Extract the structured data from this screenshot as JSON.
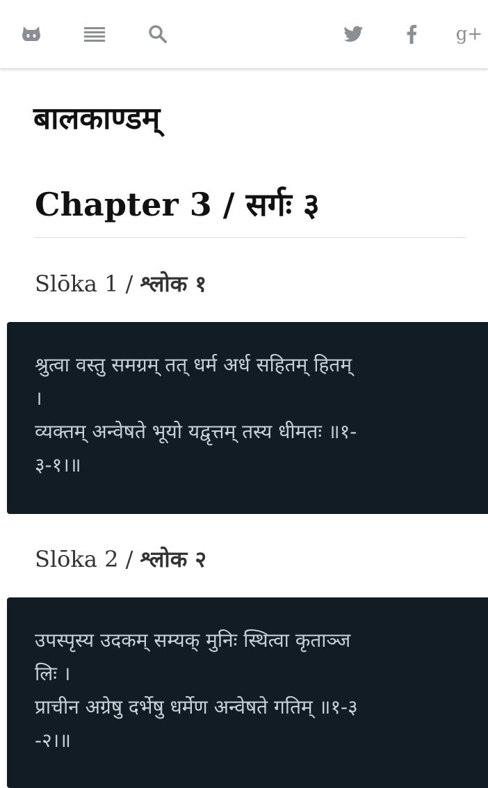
{
  "nav": {
    "left_icons": [
      "github-icon",
      "list-icon",
      "search-icon"
    ],
    "right_icons": [
      "twitter-icon",
      "facebook-icon",
      "google-plus-icon"
    ],
    "gplus_label": "g+"
  },
  "book_title": "बालकाण्डम्",
  "chapter_title": "Chapter 3 / सर्गः ३",
  "slokas": [
    {
      "heading_prefix": "Slōka 1 / ",
      "heading_deva": "श्लोक १",
      "text": "श्रुत्वा वस्तु समग्रम् तत् धर्म अर्ध सहितम् हितम्\n।\nव्यक्तम् अन्वेषते भूयो यद्वृत्तम् तस्य धीमतः ॥१-\n३-१।॥"
    },
    {
      "heading_prefix": "Slōka 2 / ",
      "heading_deva": "श्लोक २",
      "text": "उपस्पृस्य उदकम् सम्यक् मुनिः स्थित्वा कृताञ्ज\nलिः ।\nप्राचीन अग्रेषु दर्भेषु धर्मेण अन्वेषते गतिम् ॥१-३\n-२।॥"
    }
  ],
  "colors": {
    "verse_bg": "#121c24",
    "verse_text": "#c8d0d6",
    "icon": "#8a8f94"
  }
}
